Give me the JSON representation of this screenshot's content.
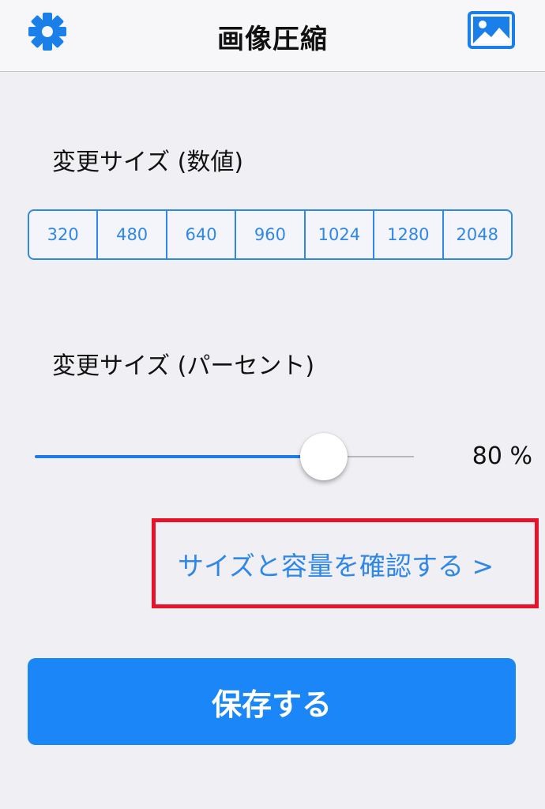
{
  "navbar": {
    "title": "画像圧縮",
    "left_icon": "gear-icon",
    "right_icon": "photo-icon"
  },
  "size_numeric": {
    "label": "変更サイズ (数値)",
    "options": [
      "320",
      "480",
      "640",
      "960",
      "1024",
      "1280",
      "2048"
    ]
  },
  "size_percent": {
    "label": "変更サイズ (パーセント)",
    "value": 80,
    "value_text": "80 %"
  },
  "check_link": {
    "label": "サイズと容量を確認する >"
  },
  "save_button": {
    "label": "保存する"
  },
  "colors": {
    "accent": "#2f87e8",
    "button": "#1a86f7",
    "highlight": "#e8132a",
    "background": "#efeff4"
  }
}
